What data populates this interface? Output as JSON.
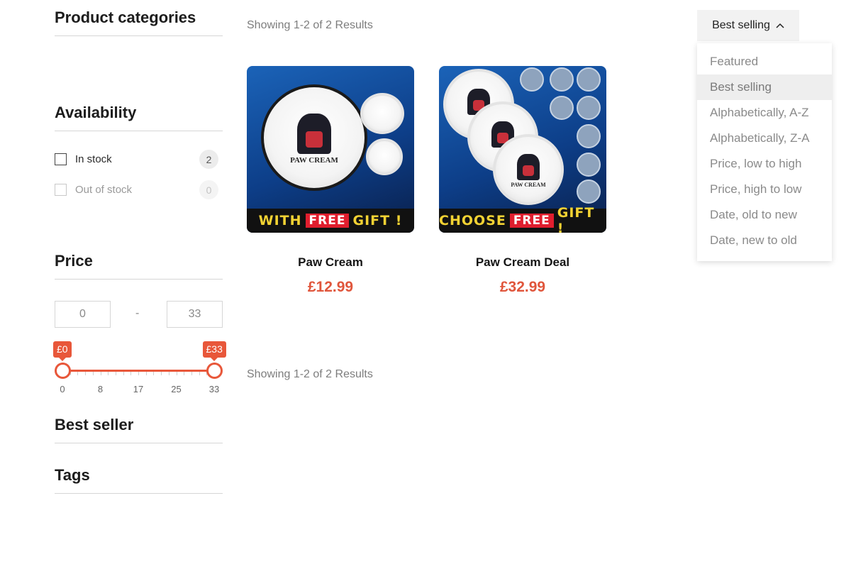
{
  "sidebar": {
    "categories_title": "Product categories",
    "availability": {
      "title": "Availability",
      "options": [
        {
          "label": "In stock",
          "count": "2",
          "disabled": false
        },
        {
          "label": "Out of stock",
          "count": "0",
          "disabled": true
        }
      ]
    },
    "price": {
      "title": "Price",
      "min_value": "0",
      "max_value": "33",
      "separator": "-",
      "min_bubble": "£0",
      "max_bubble": "£33",
      "slider_min": 0,
      "slider_max": 33,
      "selected_min": 0,
      "selected_max": 33,
      "ticks": [
        "0",
        "8",
        "17",
        "25",
        "33"
      ]
    },
    "best_seller_title": "Best seller",
    "tags_title": "Tags"
  },
  "results": {
    "top_text": "Showing 1-2 of 2 Results",
    "bottom_text": "Showing 1-2 of 2 Results"
  },
  "sort": {
    "selected": "Best selling",
    "options": [
      "Featured",
      "Best selling",
      "Alphabetically, A-Z",
      "Alphabetically, Z-A",
      "Price, low to high",
      "Price, high to low",
      "Date, old to new",
      "Date, new to old"
    ]
  },
  "products": [
    {
      "title": "Paw Cream",
      "price": "£12.99",
      "banner_before": "WITH",
      "banner_free": "FREE",
      "banner_after": "GIFT !",
      "tin_text": "PAW CREAM"
    },
    {
      "title": "Paw Cream Deal",
      "price": "£32.99",
      "banner_before": "CHOOSE",
      "banner_free": "FREE",
      "banner_after": "GIFT !",
      "tin_text": "PAW CREAM"
    }
  ],
  "colors": {
    "accent": "#e8573a",
    "price": "#e0563c",
    "banner_text": "#f2d233",
    "banner_free_bg": "#e01e2e"
  }
}
